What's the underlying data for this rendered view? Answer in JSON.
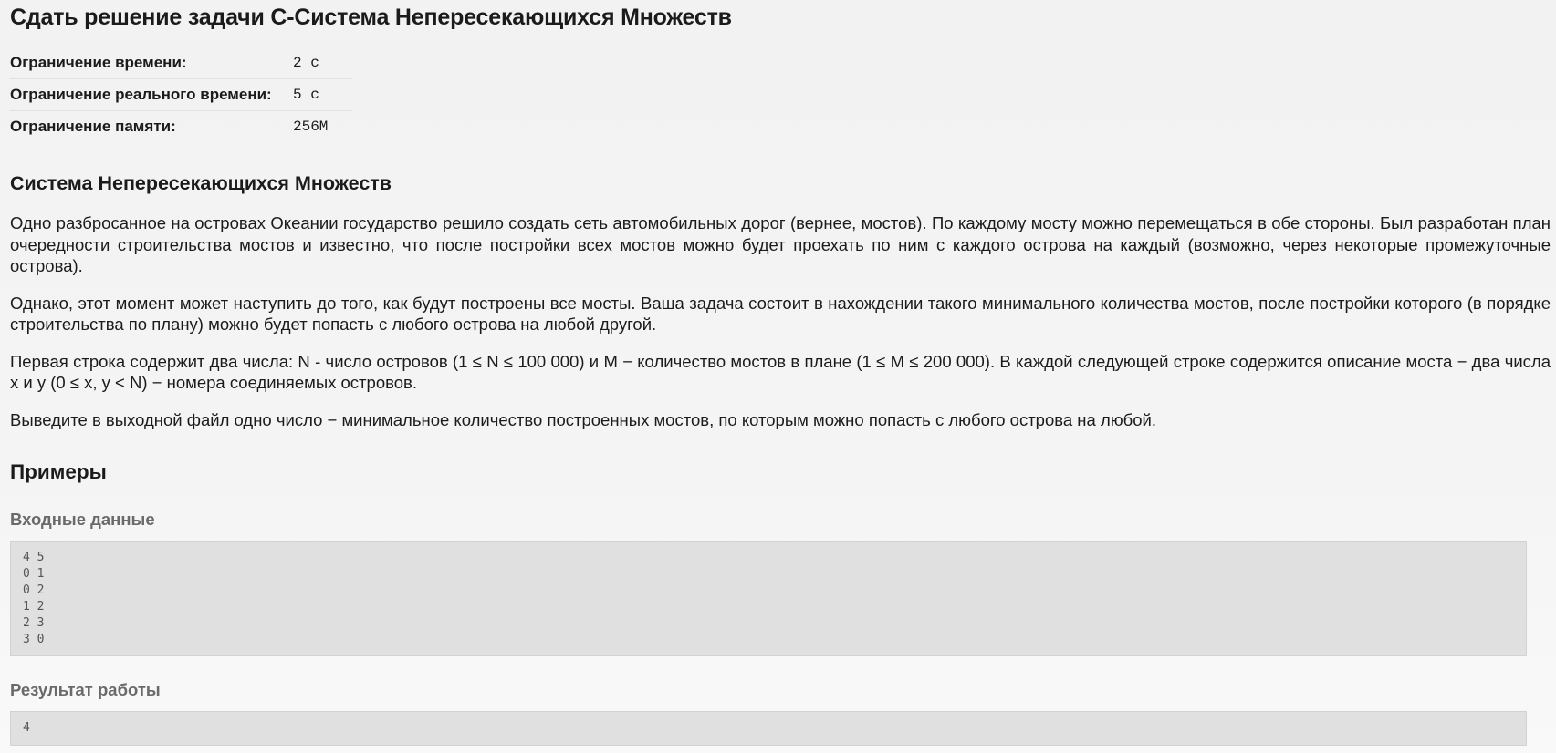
{
  "page": {
    "title": "Сдать решение задачи C-Система Непересекающихся Множеств"
  },
  "limits": [
    {
      "label": "Ограничение времени:",
      "value": "2 с"
    },
    {
      "label": "Ограничение реального времени:",
      "value": "5 с"
    },
    {
      "label": "Ограничение памяти:",
      "value": "256M"
    }
  ],
  "problem": {
    "title": "Система Непересекающихся Множеств",
    "paragraphs": [
      "Одно разбросанное на островах Океании государство решило создать сеть автомобильных дорог (вернее, мостов). По каждому мосту можно перемещаться в обе стороны. Был разработан план очередности строительства мостов и известно, что после постройки всех мостов можно будет проехать по ним с каждого острова на каждый (возможно, через некоторые промежуточные острова).",
      "Однако, этот момент может наступить до того, как будут построены все мосты. Ваша задача состоит в нахождении такого минимального количества мостов, после постройки которого (в порядке строительства по плану) можно будет попасть с любого острова на любой другой.",
      "Первая строка содержит два числа: N - число островов (1 ≤ N ≤ 100 000) и M − количество мостов в плане (1 ≤ M ≤ 200 000). В каждой следующей строке содержится описание моста − два числа x и y (0 ≤ x, y < N) − номера соединяемых островов.",
      "Выведите в выходной файл одно число − минимальное количество построенных мостов, по которым можно попасть с любого острова на любой."
    ]
  },
  "examples": {
    "title": "Примеры",
    "input_label": "Входные данные",
    "input": "4 5\n0 1\n0 2\n1 2\n2 3\n3 0",
    "output_label": "Результат работы",
    "output": "4"
  }
}
